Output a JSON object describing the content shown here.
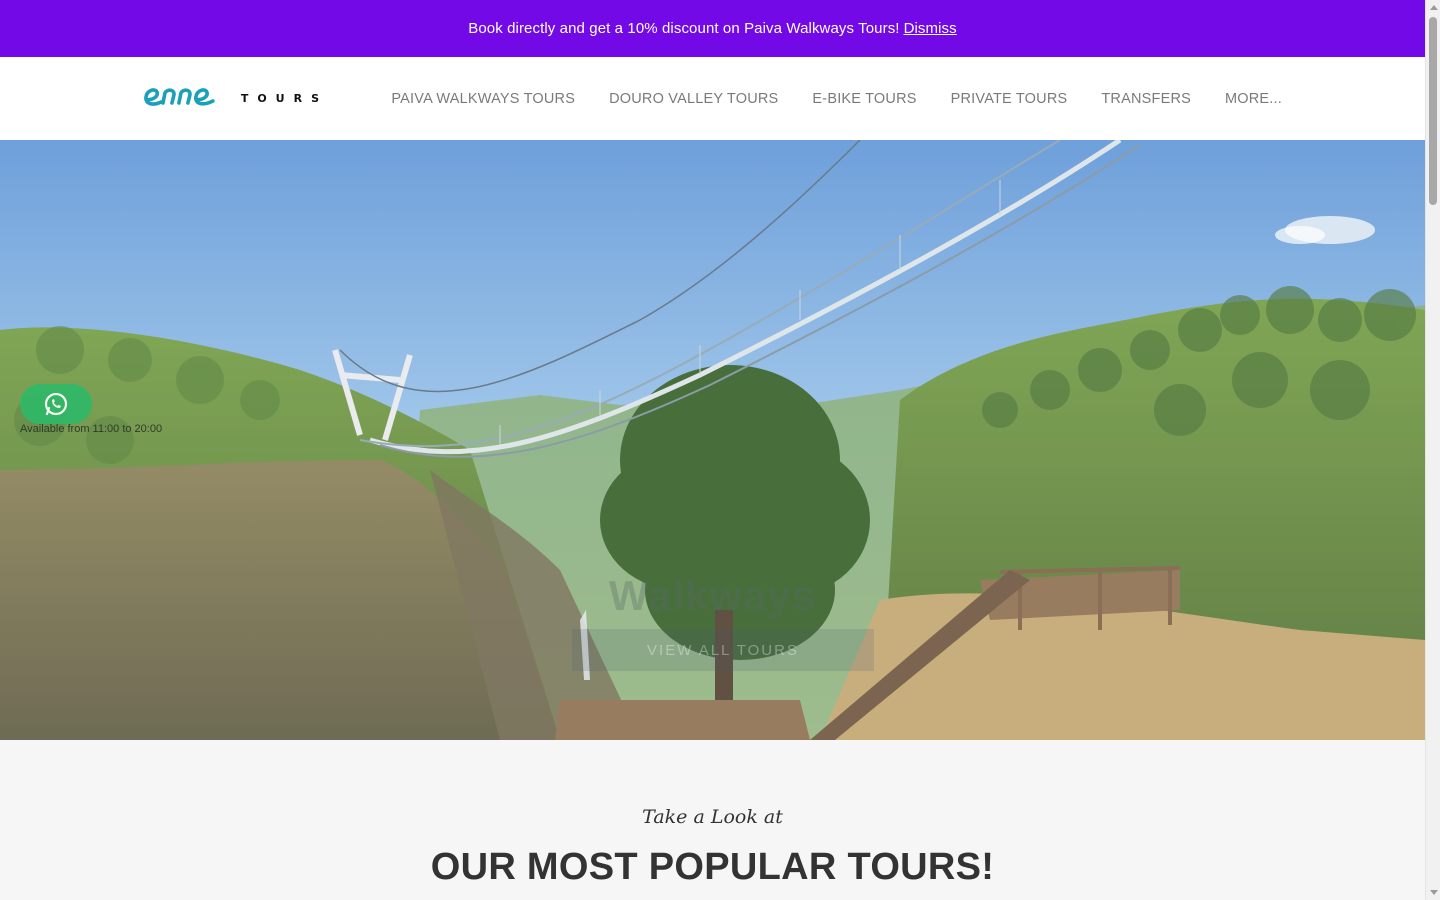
{
  "promo": {
    "message": "Book directly and get a 10% discount on Paiva Walkways Tours!",
    "dismiss_label": "Dismiss"
  },
  "brand": {
    "logo_script": "enne",
    "logo_word": "TOURS",
    "accent_color": "#1aa0b8",
    "banner_color": "#7309e6"
  },
  "nav": {
    "items": [
      "PAIVA WALKWAYS TOURS",
      "DOURO VALLEY TOURS",
      "E-BIKE TOURS",
      "PRIVATE TOURS",
      "TRANSFERS",
      "MORE..."
    ]
  },
  "hero": {
    "title": "Walkways",
    "button_label": "VIEW ALL TOURS"
  },
  "whatsapp": {
    "icon": "whatsapp-icon",
    "availability": "Available from 11:00 to 20:00"
  },
  "popular": {
    "kicker": "Take a Look at",
    "title": "OUR MOST POPULAR TOURS!"
  }
}
